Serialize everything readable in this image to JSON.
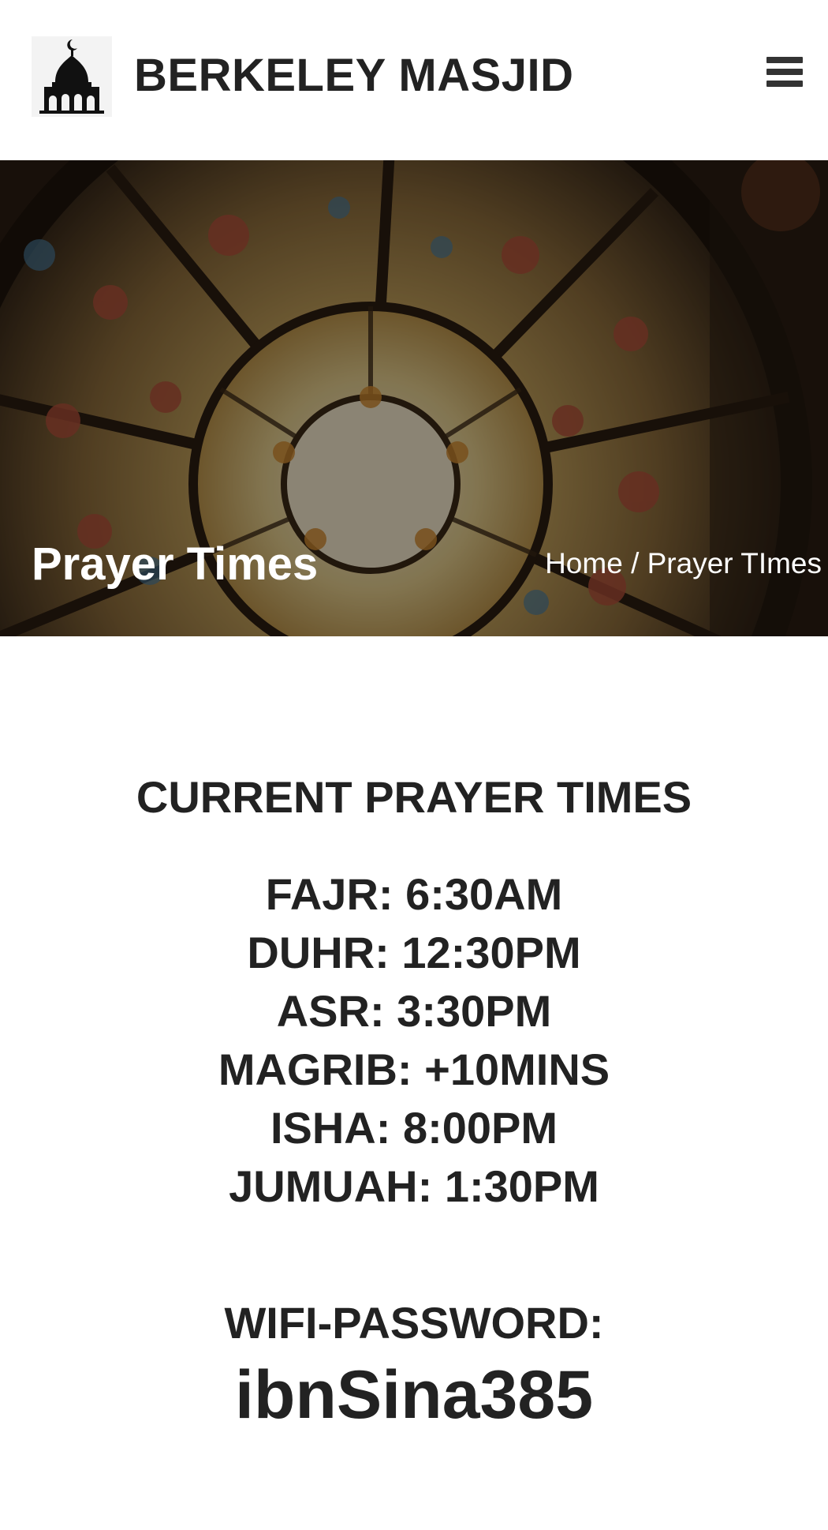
{
  "header": {
    "site_name": "BERKELEY MASJID",
    "logo_icon": "mosque-icon",
    "menu_icon": "hamburger-menu-icon"
  },
  "hero": {
    "title": "Prayer Times",
    "breadcrumb": {
      "home": "Home",
      "separator": "/",
      "current": "Prayer TImes"
    },
    "background_icon": "stained-glass-dome-image"
  },
  "content": {
    "heading": "CURRENT PRAYER TIMES",
    "times": [
      "FAJR: 6:30AM",
      "DUHR: 12:30PM",
      "ASR: 3:30PM",
      "MAGRIB: +10MINS",
      "ISHA: 8:00PM",
      "JUMUAH: 1:30PM"
    ],
    "wifi_label": "WIFI-PASSWORD:",
    "wifi_password": "ibnSina385"
  },
  "colors": {
    "text": "#222222",
    "background": "#ffffff",
    "hero_overlay": "#2a1e14"
  }
}
